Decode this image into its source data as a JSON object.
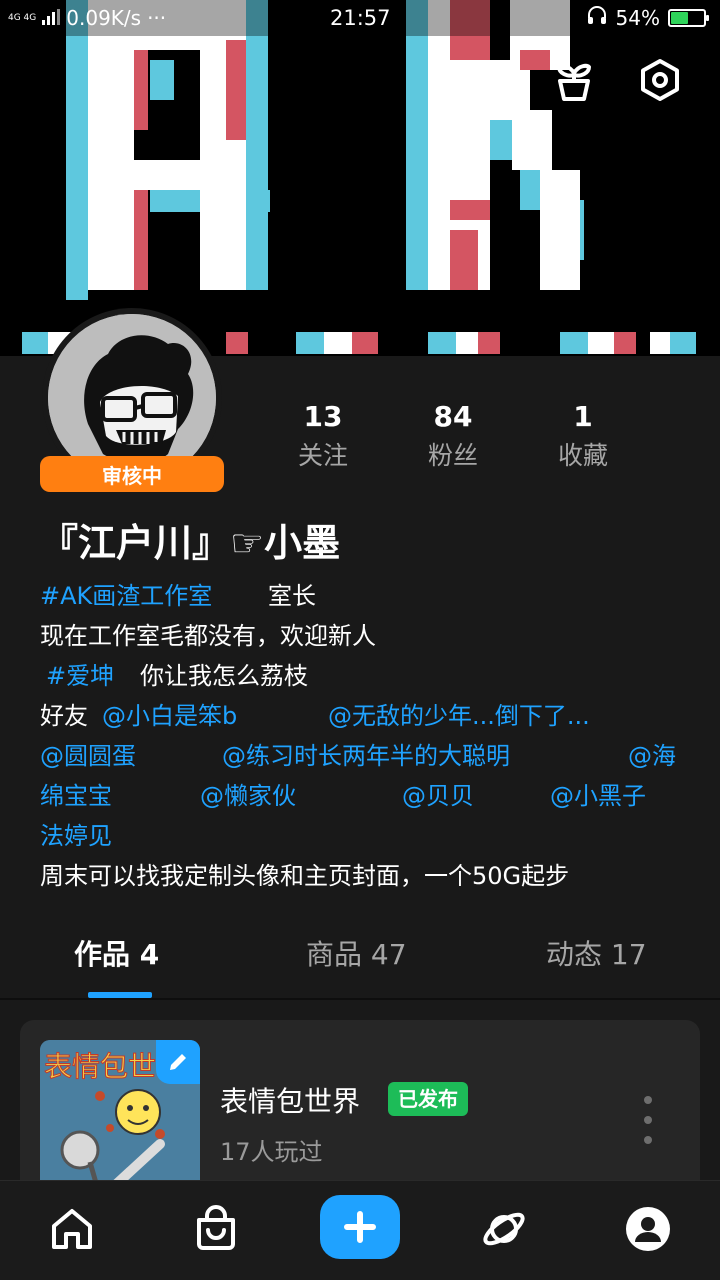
{
  "status_bar": {
    "network_type": "4G 4G",
    "speed": "0.09K/s",
    "more": "···",
    "time": "21:57",
    "battery": "54%",
    "battery_level": 0.54
  },
  "header_icons": [
    "history-icon",
    "plant-icon",
    "settings-icon"
  ],
  "profile": {
    "review_status": "审核中",
    "stats": [
      {
        "value": "13",
        "label": "关注"
      },
      {
        "value": "84",
        "label": "粉丝"
      },
      {
        "value": "1",
        "label": "收藏"
      }
    ],
    "username": "『江户川』☞小墨",
    "bio": {
      "line1": {
        "link": "#AK画渣工作室",
        "text": "室长"
      },
      "line2": "现在工作室毛都没有，欢迎新人",
      "line3": {
        "link": "#爱坤",
        "text": "你让我怎么荔枝"
      },
      "line4": {
        "text": "好友",
        "link1": "@小白是笨b",
        "link2": "@无敌的少年...倒下了..."
      },
      "line5": {
        "link1": "@圆圆蛋",
        "link2": "@练习时长两年半的大聪明",
        "link3": "@海"
      },
      "line6": {
        "link1": "绵宝宝",
        "link2": "@懒家伙",
        "link3": "@贝贝",
        "link4": "@小黑子"
      },
      "line7": "法婷见",
      "line8": "周末可以找我定制头像和主页封面，一个50G起步"
    }
  },
  "tabs": [
    {
      "label": "作品",
      "count": "4",
      "active": true
    },
    {
      "label": "商品",
      "count": "47",
      "active": false
    },
    {
      "label": "动态",
      "count": "17",
      "active": false
    }
  ],
  "work": {
    "title": "表情包世界",
    "status": "已发布",
    "plays": "17人玩过",
    "thumb_text": "表情包世界"
  },
  "bottom_nav": [
    "home-icon",
    "shop-bag-icon",
    "create-plus-icon",
    "planet-icon",
    "profile-icon"
  ],
  "colors": {
    "accent": "#1fa2ff",
    "review_orange": "#ff7f11",
    "published_green": "#1dbc58",
    "background": "#191919",
    "banner_red": "#d45562",
    "banner_cyan": "#5ec8de"
  }
}
